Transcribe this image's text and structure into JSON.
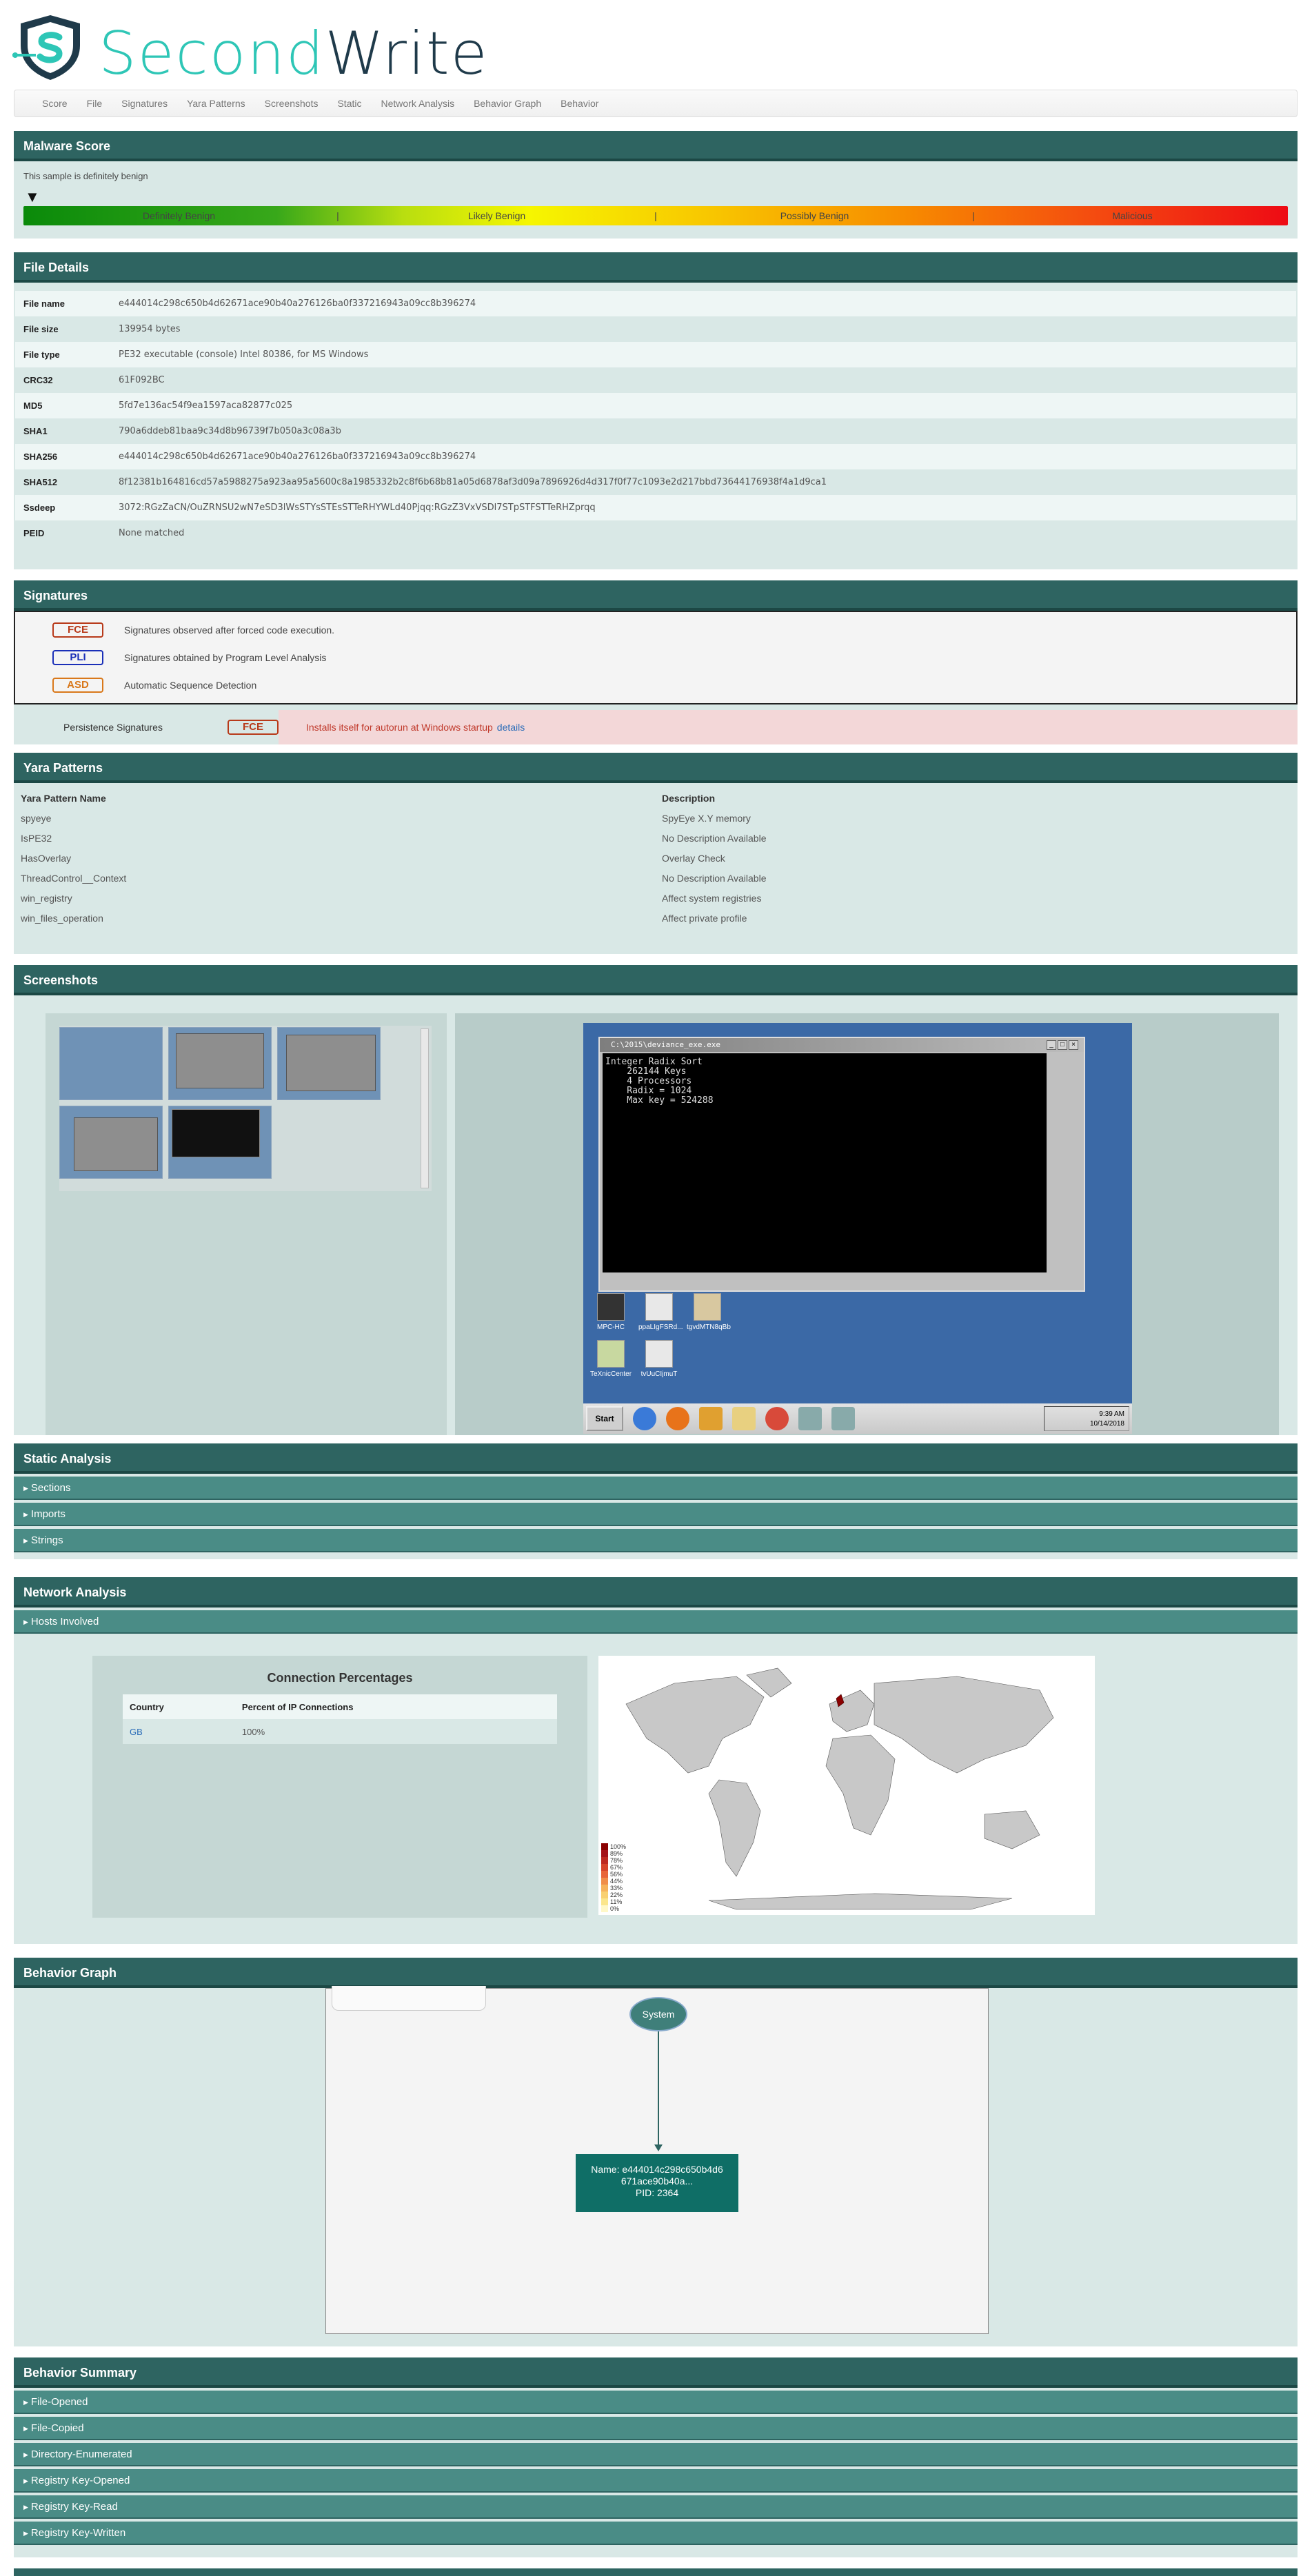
{
  "brand": {
    "second": "Second",
    "write": "Write"
  },
  "nav": [
    "Score",
    "File",
    "Signatures",
    "Yara Patterns",
    "Screenshots",
    "Static",
    "Network Analysis",
    "Behavior Graph",
    "Behavior"
  ],
  "malware_score": {
    "title": "Malware Score",
    "verdict": "This sample is definitely benign",
    "pointer": "▼",
    "scale": [
      "Definitely Benign",
      "Likely Benign",
      "Possibly Benign",
      "Malicious"
    ],
    "separator": "|"
  },
  "file_details": {
    "title": "File Details",
    "rows": [
      {
        "k": "File name",
        "v": "e444014c298c650b4d62671ace90b40a276126ba0f337216943a09cc8b396274"
      },
      {
        "k": "File size",
        "v": "139954 bytes"
      },
      {
        "k": "File type",
        "v": "PE32 executable (console) Intel 80386, for MS Windows"
      },
      {
        "k": "CRC32",
        "v": "61F092BC"
      },
      {
        "k": "MD5",
        "v": "5fd7e136ac54f9ea1597aca82877c025"
      },
      {
        "k": "SHA1",
        "v": "790a6ddeb81baa9c34d8b96739f7b050a3c08a3b"
      },
      {
        "k": "SHA256",
        "v": "e444014c298c650b4d62671ace90b40a276126ba0f337216943a09cc8b396274"
      },
      {
        "k": "SHA512",
        "v": "8f12381b164816cd57a5988275a923aa95a5600c8a1985332b2c8f6b68b81a05d6878af3d09a7896926d4d317f0f77c1093e2d217bbd73644176938f4a1d9ca1"
      },
      {
        "k": "Ssdeep",
        "v": "3072:RGzZaCN/OuZRNSU2wN7eSD3lWsSTYsSTEsSTTeRHYWLd40Pjqq:RGzZ3VxVSDl7STpSTFSTTeRHZprqq"
      },
      {
        "k": "PEID",
        "v": "None matched"
      }
    ]
  },
  "signatures": {
    "title": "Signatures",
    "legend": [
      {
        "badge": "FCE",
        "desc": "Signatures observed after forced code execution."
      },
      {
        "badge": "PLI",
        "desc": "Signatures obtained by Program Level Analysis"
      },
      {
        "badge": "ASD",
        "desc": "Automatic Sequence Detection"
      }
    ],
    "persistence": {
      "label": "Persistence Signatures",
      "badge": "FCE",
      "text": "Installs itself for autorun at Windows startup",
      "link": "details"
    }
  },
  "yara": {
    "title": "Yara Patterns",
    "col_name": "Yara Pattern Name",
    "col_desc": "Description",
    "rows": [
      {
        "name": "spyeye",
        "desc": "SpyEye X.Y memory"
      },
      {
        "name": "IsPE32",
        "desc": "No Description Available"
      },
      {
        "name": "HasOverlay",
        "desc": "Overlay Check"
      },
      {
        "name": "ThreadControl__Context",
        "desc": "No Description Available"
      },
      {
        "name": "win_registry",
        "desc": "Affect system registries"
      },
      {
        "name": "win_files_operation",
        "desc": "Affect private profile"
      }
    ]
  },
  "screenshots": {
    "title": "Screenshots",
    "window_title": "C:\\2015\\deviance_exe.exe",
    "console": "Integer Radix Sort\n    262144 Keys\n    4 Processors\n    Radix = 1024\n    Max key = 524288",
    "desktop_icons": [
      "MPC-HC",
      "ppaLIgFSRd...",
      "tgvdMTN8qBb",
      "TeXnicCenter",
      "tvUuCIjmuT"
    ],
    "start": "Start",
    "clock_time": "9:39 AM",
    "clock_date": "10/14/2018"
  },
  "static_analysis": {
    "title": "Static Analysis",
    "items": [
      "Sections",
      "Imports",
      "Strings"
    ]
  },
  "network": {
    "title": "Network Analysis",
    "hosts_label": "Hosts Involved",
    "conn_title": "Connection Percentages",
    "col_country": "Country",
    "col_percent": "Percent of IP Connections",
    "rows": [
      {
        "country": "GB",
        "percent": "100%"
      }
    ],
    "legend": [
      "100%",
      "89%",
      "78%",
      "67%",
      "56%",
      "44%",
      "33%",
      "22%",
      "11%",
      "0%"
    ],
    "legend_colors": [
      "#8b0000",
      "#a4141a",
      "#bd2a22",
      "#d6462c",
      "#e8663a",
      "#f08e4a",
      "#f6b35c",
      "#f9d070",
      "#fbe68c",
      "#fff8c8"
    ]
  },
  "behavior_graph": {
    "title": "Behavior Graph",
    "root": "System",
    "proc_name": "Name: e444014c298c650b4d6",
    "proc_name2": "671ace90b40a...",
    "proc_pid": "PID: 2364"
  },
  "behavior_summary": {
    "title": "Behavior Summary",
    "items": [
      "File-Opened",
      "File-Copied",
      "Directory-Enumerated",
      "Registry Key-Opened",
      "Registry Key-Read",
      "Registry Key-Written"
    ]
  }
}
